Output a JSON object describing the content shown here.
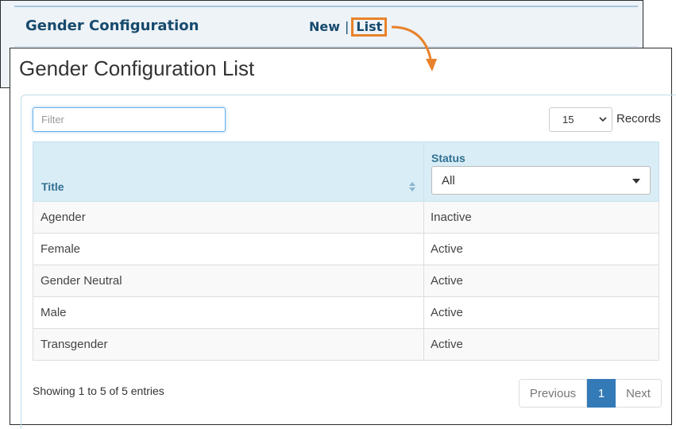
{
  "background_window": {
    "title": "Gender Configuration",
    "nav": {
      "new_label": "New",
      "separator": "|",
      "list_label": "List"
    }
  },
  "page": {
    "title": "Gender Configuration List"
  },
  "filter": {
    "placeholder": "Filter",
    "value": ""
  },
  "records": {
    "selected": "15",
    "label": "Records"
  },
  "table": {
    "columns": {
      "title": "Title",
      "status": "Status"
    },
    "status_filter": {
      "selected": "All"
    },
    "rows": [
      {
        "title": "Agender",
        "status": "Inactive"
      },
      {
        "title": "Female",
        "status": "Active"
      },
      {
        "title": "Gender Neutral",
        "status": "Active"
      },
      {
        "title": "Male",
        "status": "Active"
      },
      {
        "title": "Transgender",
        "status": "Active"
      }
    ]
  },
  "footer": {
    "showing_text": "Showing 1 to 5 of 5 entries"
  },
  "pagination": {
    "previous_label": "Previous",
    "current_page": "1",
    "next_label": "Next"
  },
  "colors": {
    "highlight": "#e8822a",
    "header_bg": "#d9edf7",
    "header_text": "#31708f",
    "active_page": "#337ab7"
  }
}
